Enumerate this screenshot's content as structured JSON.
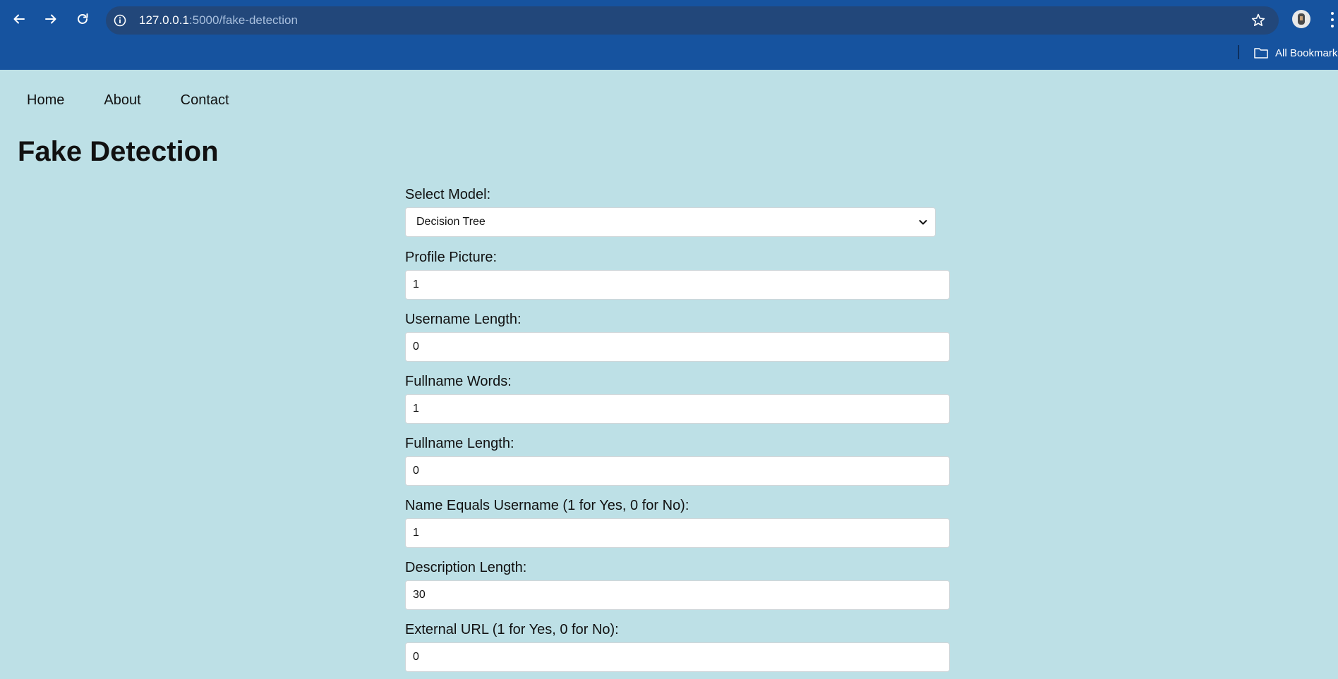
{
  "browser": {
    "url_host": "127.0.0.1",
    "url_path": ":5000/fake-detection",
    "bookmarks_label": "All Bookmarks"
  },
  "nav": {
    "items": [
      {
        "label": "Home"
      },
      {
        "label": "About"
      },
      {
        "label": "Contact"
      }
    ]
  },
  "page": {
    "title": "Fake Detection"
  },
  "form": {
    "model": {
      "label": "Select Model:",
      "selected": "Decision Tree"
    },
    "fields": [
      {
        "label": "Profile Picture:",
        "value": "1"
      },
      {
        "label": "Username Length:",
        "value": "0"
      },
      {
        "label": "Fullname Words:",
        "value": "1"
      },
      {
        "label": "Fullname Length:",
        "value": "0"
      },
      {
        "label": "Name Equals Username (1 for Yes, 0 for No):",
        "value": "1"
      },
      {
        "label": "Description Length:",
        "value": "30"
      },
      {
        "label": "External URL (1 for Yes, 0 for No):",
        "value": "0"
      }
    ]
  }
}
